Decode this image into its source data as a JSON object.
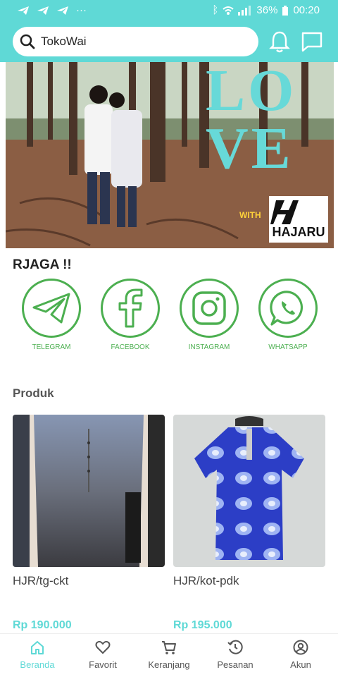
{
  "statusbar": {
    "battery": "36%",
    "time": "00:20",
    "icons": [
      "telegram-icon",
      "telegram-icon",
      "more-icon",
      "bluetooth-icon",
      "wifi-icon",
      "signal-icon",
      "battery-icon"
    ]
  },
  "search": {
    "value": "TokoWai"
  },
  "header_icons": [
    "bell-icon",
    "chat-icon"
  ],
  "banner": {
    "headline_line1": "LO",
    "headline_line2": "VE",
    "with_label": "WITH",
    "brand": "HAJARU"
  },
  "social": {
    "title": "RJAGA !!",
    "items": [
      {
        "label": "TELEGRAM",
        "icon": "telegram-icon"
      },
      {
        "label": "FACEBOOK",
        "icon": "facebook-icon"
      },
      {
        "label": "INSTAGRAM",
        "icon": "instagram-icon"
      },
      {
        "label": "WHATSAPP",
        "icon": "whatsapp-icon"
      }
    ],
    "accent": "#4caf50"
  },
  "produk": {
    "title": "Produk",
    "items": [
      {
        "name": "HJR/tg-ckt",
        "price": "Rp 190.000"
      },
      {
        "name": "HJR/kot-pdk",
        "price": "Rp 195.000"
      }
    ]
  },
  "bottomnav": {
    "items": [
      {
        "label": "Beranda",
        "icon": "home-icon",
        "active": true
      },
      {
        "label": "Favorit",
        "icon": "heart-icon",
        "active": false
      },
      {
        "label": "Keranjang",
        "icon": "cart-icon",
        "active": false
      },
      {
        "label": "Pesanan",
        "icon": "history-icon",
        "active": false
      },
      {
        "label": "Akun",
        "icon": "account-icon",
        "active": false
      }
    ]
  },
  "colors": {
    "brand": "#5fd9d6",
    "social_green": "#4caf50"
  }
}
